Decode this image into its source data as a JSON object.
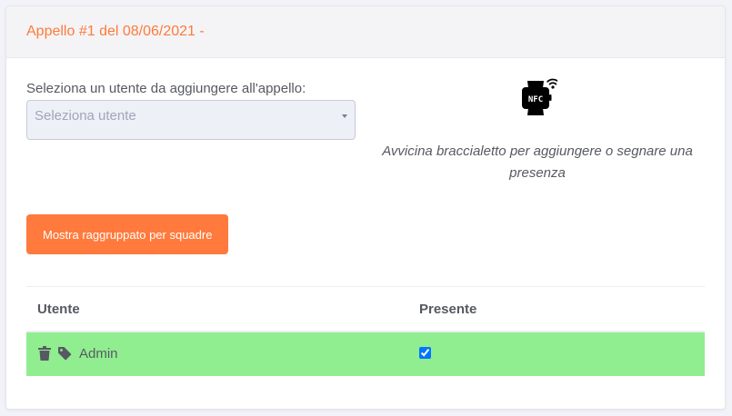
{
  "header": {
    "title": "Appello #1 del 08/06/2021 -"
  },
  "form": {
    "select_label": "Seleziona un utente da aggiungere all'appello:",
    "select_placeholder": "Seleziona utente"
  },
  "nfc": {
    "icon": "nfc-watch-icon",
    "icon_label": "NFC",
    "message": "Avvicina braccialetto per aggiungere o segnare una presenza"
  },
  "actions": {
    "group_button_label": "Mostra raggruppato per squadre"
  },
  "table": {
    "columns": [
      "Utente",
      "Presente"
    ],
    "rows": [
      {
        "name": "Admin",
        "present": true,
        "row_color": "#90ee90",
        "icons": [
          "trash-icon",
          "tag-icon"
        ]
      }
    ]
  },
  "colors": {
    "accent": "#ff7a3c",
    "present_row": "#90ee90",
    "text": "#575962",
    "placeholder": "#a2a5b9"
  }
}
